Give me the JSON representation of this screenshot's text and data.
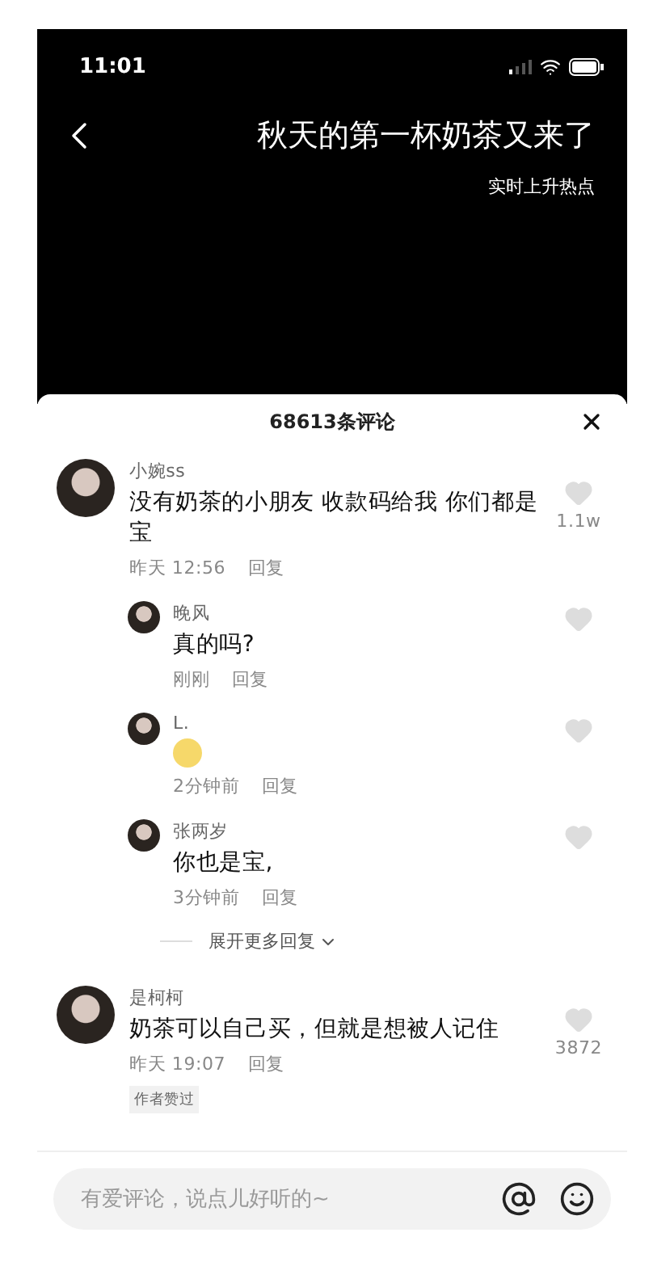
{
  "status_bar": {
    "time": "11:01"
  },
  "video": {
    "title": "秋天的第一杯奶茶又来了",
    "subtitle": "实时上升热点"
  },
  "comments_header": {
    "title": "68613条评论"
  },
  "comments": [
    {
      "author": "小婉ss",
      "text": "没有奶茶的小朋友 收款码给我 你们都是宝",
      "time": "昨天 12:56",
      "reply_label": "回复",
      "likes": "1.1w",
      "replies": [
        {
          "author": "晚风",
          "kind": "text",
          "text": "真的吗?",
          "time": "刚刚",
          "reply_label": "回复"
        },
        {
          "author": "L.",
          "kind": "emoji",
          "time": "2分钟前",
          "reply_label": "回复"
        },
        {
          "author": "张两岁",
          "kind": "text",
          "text": "你也是宝,",
          "time": "3分钟前",
          "reply_label": "回复"
        }
      ],
      "more_replies": "展开更多回复"
    },
    {
      "author": "是柯柯",
      "text": "奶茶可以自己买，但就是想被人记住",
      "time": "昨天 19:07",
      "reply_label": "回复",
      "likes": "3872",
      "badge": "作者赞过"
    }
  ],
  "input": {
    "placeholder": "有爱评论，说点儿好听的~"
  }
}
